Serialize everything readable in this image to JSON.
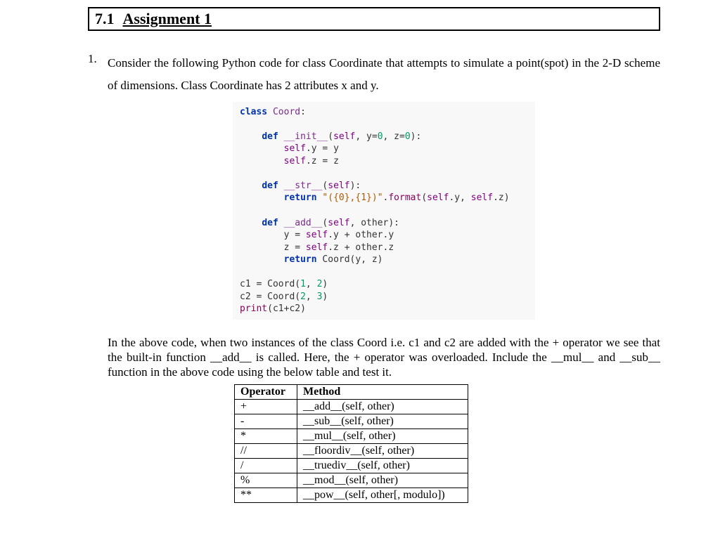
{
  "section": {
    "number": "7.1",
    "title": "Assignment 1"
  },
  "question": {
    "number": "1.",
    "lead": "Consider the following Python code for class Coordinate that attempts to simulate a point(spot) in the 2-D scheme of dimensions. Class Coordinate has 2 attributes x and y.",
    "followup": "In the above code, when two instances of the class Coord i.e. c1 and c2 are added with the + operator we see that the built-in function __add__ is called. Here, the + operator was overloaded. Include the __mul__ and __sub__ function in the above code using the below table and test it."
  },
  "code_tokens": [
    [
      "kw",
      "class"
    ],
    [
      "",
      " "
    ],
    [
      "fn",
      "Coord"
    ],
    [
      "",
      ":\n\n    "
    ],
    [
      "kw",
      "def"
    ],
    [
      "",
      " "
    ],
    [
      "fn",
      "__init__"
    ],
    [
      "",
      "("
    ],
    [
      "obj",
      "self"
    ],
    [
      "",
      ", y="
    ],
    [
      "num-lit",
      "0"
    ],
    [
      "",
      ", z="
    ],
    [
      "num-lit",
      "0"
    ],
    [
      "",
      "):\n        "
    ],
    [
      "obj",
      "self"
    ],
    [
      "",
      ".y = y\n        "
    ],
    [
      "obj",
      "self"
    ],
    [
      "",
      ".z = z\n\n    "
    ],
    [
      "kw",
      "def"
    ],
    [
      "",
      " "
    ],
    [
      "fn",
      "__str__"
    ],
    [
      "",
      "("
    ],
    [
      "obj",
      "self"
    ],
    [
      "",
      "):\n        "
    ],
    [
      "kw",
      "return"
    ],
    [
      "",
      " "
    ],
    [
      "str",
      "\"({0},{1})\""
    ],
    [
      "",
      "."
    ],
    [
      "bi",
      "format"
    ],
    [
      "",
      "("
    ],
    [
      "obj",
      "self"
    ],
    [
      "",
      ".y, "
    ],
    [
      "obj",
      "self"
    ],
    [
      "",
      ".z)\n\n    "
    ],
    [
      "kw",
      "def"
    ],
    [
      "",
      " "
    ],
    [
      "fn",
      "__add__"
    ],
    [
      "",
      "("
    ],
    [
      "obj",
      "self"
    ],
    [
      "",
      ", other):\n        y = "
    ],
    [
      "obj",
      "self"
    ],
    [
      "",
      ".y + other.y\n        z = "
    ],
    [
      "obj",
      "self"
    ],
    [
      "",
      ".z + other.z\n        "
    ],
    [
      "kw",
      "return"
    ],
    [
      "",
      " Coord(y, z)\n\n"
    ],
    [
      "",
      "c1 = Coord("
    ],
    [
      "num-lit",
      "1"
    ],
    [
      "",
      ", "
    ],
    [
      "num-lit",
      "2"
    ],
    [
      "",
      ")\n"
    ],
    [
      "",
      "c2 = Coord("
    ],
    [
      "num-lit",
      "2"
    ],
    [
      "",
      ", "
    ],
    [
      "num-lit",
      "3"
    ],
    [
      "",
      ")\n"
    ],
    [
      "bi",
      "print"
    ],
    [
      "",
      "(c1+c2)"
    ]
  ],
  "table": {
    "headers": {
      "operator": "Operator",
      "method": "Method"
    },
    "rows": [
      {
        "op": "+",
        "method": "__add__(self, other)"
      },
      {
        "op": "-",
        "method": "__sub__(self, other)"
      },
      {
        "op": "*",
        "method": "__mul__(self, other)"
      },
      {
        "op": "//",
        "method": "__floordiv__(self, other)"
      },
      {
        "op": "/",
        "method": "__truediv__(self, other)"
      },
      {
        "op": "%",
        "method": "__mod__(self, other)"
      },
      {
        "op": "**",
        "method": "__pow__(self, other[, modulo])"
      }
    ]
  }
}
